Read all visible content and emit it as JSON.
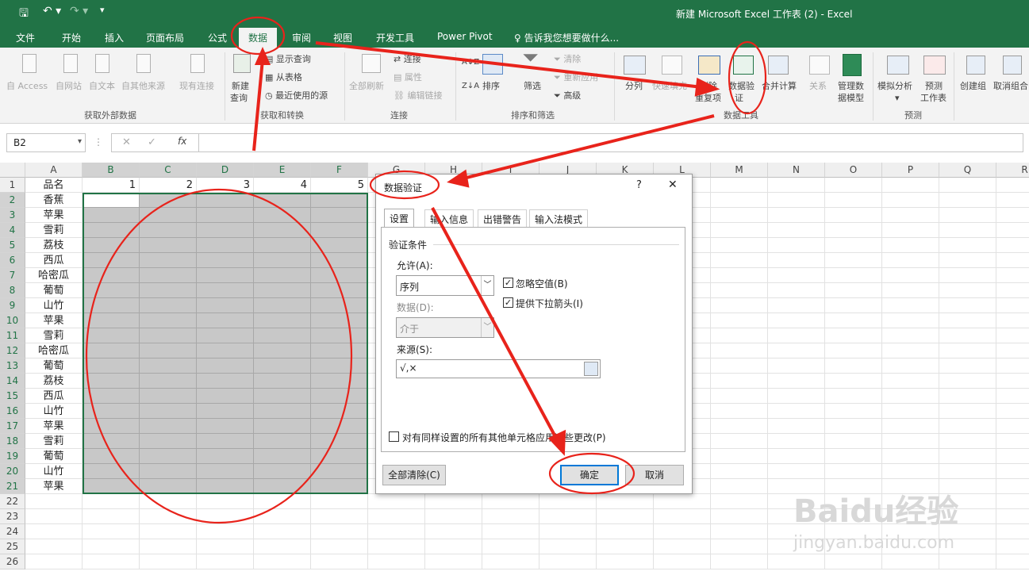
{
  "window": {
    "title": "新建 Microsoft Excel 工作表 (2) - Excel",
    "qat": {
      "save_icon": "save-icon",
      "undo_icon": "undo-icon",
      "redo_icon": "redo-icon",
      "customize_icon": "customize-qat-icon"
    }
  },
  "tabs": [
    "文件",
    "开始",
    "插入",
    "页面布局",
    "公式",
    "数据",
    "审阅",
    "视图",
    "开发工具",
    "Power Pivot"
  ],
  "active_tab": "数据",
  "tell_me": "告诉我您想要做什么...",
  "ribbon": {
    "get_external": {
      "label": "获取外部数据",
      "items": [
        "自 Access",
        "自网站",
        "自文本",
        "自其他来源",
        "现有连接"
      ]
    },
    "transform": {
      "label": "获取和转换",
      "new_query": [
        "新建",
        "查询"
      ],
      "items": [
        "显示查询",
        "从表格",
        "最近使用的源"
      ]
    },
    "connections": {
      "label": "连接",
      "refresh_all": [
        "全部刷新"
      ],
      "items": [
        "连接",
        "属性",
        "编辑链接"
      ]
    },
    "sort_filter": {
      "label": "排序和筛选",
      "sort": "排序",
      "filter": "筛选",
      "items": [
        "清除",
        "重新应用",
        "高级"
      ]
    },
    "data_tools": {
      "label": "数据工具",
      "items": [
        "分列",
        "快速填充",
        "删除",
        "重复项",
        "数据验",
        "证",
        "合并计算",
        "关系",
        "管理数",
        "据模型"
      ]
    },
    "forecast": {
      "label": "预测",
      "items": [
        "模拟分析",
        "预测",
        "工作表"
      ]
    },
    "outline": {
      "items": [
        "创建组",
        "取消组合"
      ]
    }
  },
  "formula_bar": {
    "name_box": "B2",
    "cancel": "✕",
    "enter": "✓",
    "fx": "fx",
    "value": ""
  },
  "columns": [
    "A",
    "B",
    "C",
    "D",
    "E",
    "F",
    "G",
    "H",
    "I",
    "J",
    "K",
    "L",
    "M",
    "N",
    "O",
    "P",
    "Q",
    "R"
  ],
  "rows": [
    "1",
    "2",
    "3",
    "4",
    "5",
    "6",
    "7",
    "8",
    "9",
    "10",
    "11",
    "12",
    "13",
    "14",
    "15",
    "16",
    "17",
    "18",
    "19",
    "20",
    "21",
    "22",
    "23",
    "24",
    "25",
    "26"
  ],
  "header_row": {
    "a1": "品名",
    "numbers": [
      "1",
      "2",
      "3",
      "4",
      "5"
    ]
  },
  "items": [
    "香蕉",
    "苹果",
    "雪莉",
    "荔枝",
    "西瓜",
    "哈密瓜",
    "葡萄",
    "山竹",
    "苹果",
    "雪莉",
    "哈密瓜",
    "葡萄",
    "荔枝",
    "西瓜",
    "山竹",
    "苹果",
    "雪莉",
    "葡萄",
    "山竹",
    "苹果"
  ],
  "dialog": {
    "title": "数据验证",
    "help": "?",
    "close": "✕",
    "tabs": [
      "设置",
      "输入信息",
      "出错警告",
      "输入法模式"
    ],
    "section": "验证条件",
    "allow_label": "允许(A):",
    "allow_value": "序列",
    "data_label": "数据(D):",
    "data_value": "介于",
    "ignore_blank": "忽略空值(B)",
    "dropdown": "提供下拉箭头(I)",
    "source_label": "来源(S):",
    "source_value": "√,×",
    "apply_all": "对有同样设置的所有其他单元格应用这些更改(P)",
    "clear_all": "全部清除(C)",
    "ok": "确定",
    "cancel": "取消"
  },
  "watermark": {
    "logo": "Baidu经验",
    "url": "jingyan.baidu.com"
  },
  "colors": {
    "excel_green": "#217346",
    "annotation_red": "#e8231b",
    "selection_gray": "#c8c8c8"
  }
}
